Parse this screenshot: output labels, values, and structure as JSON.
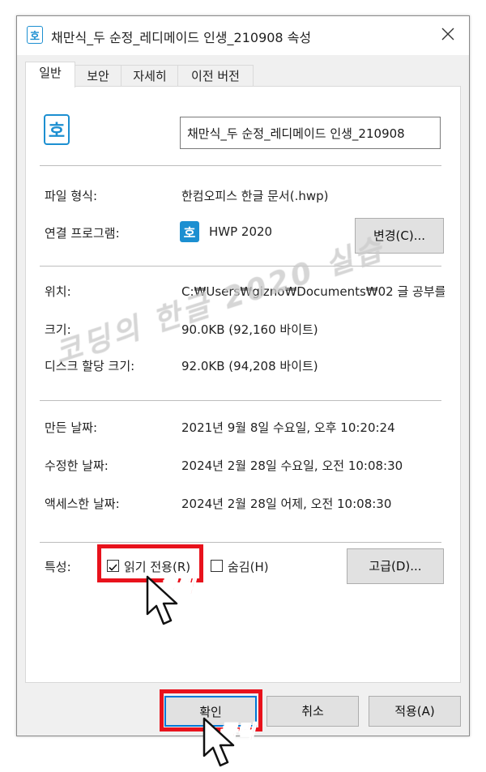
{
  "window": {
    "title": "채만식_두 순정_레디메이드 인생_210908 속성"
  },
  "icons": {
    "title": "hwp-document-icon",
    "close": "close-icon",
    "file": "hwp-document-icon",
    "program": "hwp-app-icon",
    "hwp_letter": "호",
    "brand_color": "#1c8fd1"
  },
  "tabs": [
    {
      "label": "일반",
      "active": true
    },
    {
      "label": "보안",
      "active": false
    },
    {
      "label": "자세히",
      "active": false
    },
    {
      "label": "이전 버전",
      "active": false
    }
  ],
  "general": {
    "filename": "채만식_두 순정_레디메이드 인생_210908",
    "file_type_label": "파일 형식:",
    "file_type_value": "한컴오피스 한글 문서(.hwp)",
    "opens_with_label": "연결 프로그램:",
    "opens_with_value": "HWP 2020",
    "change_button": "변경(C)...",
    "location_label": "위치:",
    "location_value": "C:₩Users₩gizno₩Documents₩02 글 공부를",
    "size_label": "크기:",
    "size_value": "90.0KB (92,160 바이트)",
    "size_on_disk_label": "디스크 할당 크기:",
    "size_on_disk_value": "92.0KB (94,208 바이트)",
    "created_label": "만든 날짜:",
    "created_value": "2021년 9월 8일 수요일, 오후 10:20:24",
    "modified_label": "수정한 날짜:",
    "modified_value": "2024년 2월 28일 수요일, 오전 10:08:30",
    "accessed_label": "액세스한 날짜:",
    "accessed_value": "2024년 2월 28일 어제, 오전 10:08:30",
    "attributes_label": "특성:",
    "readonly_label": "읽기 전용(R)",
    "readonly_checked": true,
    "hidden_label": "숨김(H)",
    "hidden_checked": false,
    "advanced_button": "고급(D)..."
  },
  "footer": {
    "ok_button": "확인",
    "cancel_button": "취소",
    "apply_button": "적용(A)"
  },
  "annotations": {
    "click_text_1": "클릭",
    "click_text_2": "클릭",
    "highlight_color": "#e8121c"
  },
  "watermark": {
    "text": "코딩의 한글 2020 실습"
  }
}
